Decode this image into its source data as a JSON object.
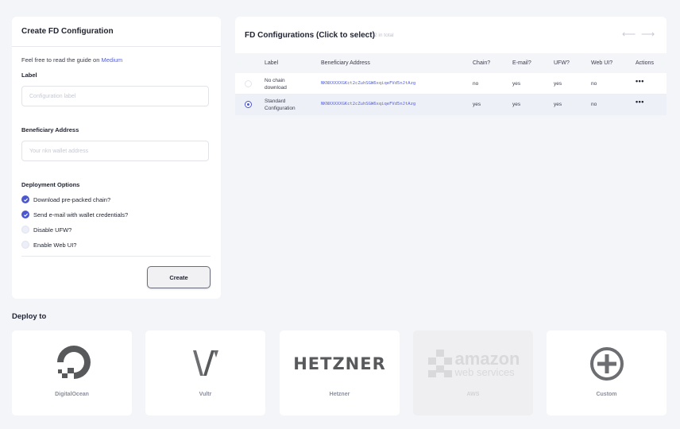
{
  "form": {
    "title": "Create FD Configuration",
    "guide_text": "Feel free to read the guide on ",
    "guide_link": "Medium",
    "label_heading": "Label",
    "label_placeholder": "Configuration label",
    "address_heading": "Beneficiary Address",
    "address_placeholder": "Your nkn wallet address",
    "options_heading": "Deployment Options",
    "options": [
      {
        "label": "Download pre-packed chain?",
        "checked": true
      },
      {
        "label": "Send e-mail with wallet credentials?",
        "checked": true
      },
      {
        "label": "Disable UFW?",
        "checked": false
      },
      {
        "label": "Enable Web UI?",
        "checked": false
      }
    ],
    "create_label": "Create"
  },
  "table": {
    "title": "FD Configurations (Click to select)",
    "total": "2 in total",
    "prev_arrow": "⟵",
    "next_arrow": "⟶",
    "columns": [
      "Label",
      "Beneficiary Address",
      "Chain?",
      "E-mail?",
      "UFW?",
      "Web UI?",
      "Actions"
    ],
    "rows": [
      {
        "label_1": "No chain",
        "label_2": "download",
        "address": "NKNXXXXXGKct2cZuhSGW6xqiqeFVd5nJtAzg",
        "chain": "no",
        "email": "yes",
        "ufw": "yes",
        "webui": "no",
        "actions": "•••",
        "selected": false
      },
      {
        "label_1": "Standard",
        "label_2": "Configuration",
        "address": "NKNXXXXXGKct2cZuhSGW6xqiqeFVd5nJtAzg",
        "chain": "yes",
        "email": "yes",
        "ufw": "yes",
        "webui": "no",
        "actions": "•••",
        "selected": true
      }
    ]
  },
  "deploy": {
    "title": "Deploy to",
    "providers": [
      {
        "name": "DigitalOcean",
        "icon": "digitalocean-logo-icon",
        "disabled": false
      },
      {
        "name": "Vultr",
        "icon": "vultr-logo-icon",
        "disabled": false
      },
      {
        "name": "Hetzner",
        "icon": "hetzner-logo-icon",
        "logo_text": "HETZNER",
        "disabled": false
      },
      {
        "name": "AWS",
        "icon": "aws-logo-icon",
        "logo_text_1": "amazon",
        "logo_text_2": "web services",
        "disabled": true
      },
      {
        "name": "Custom",
        "icon": "plus-circle-icon",
        "disabled": false
      }
    ]
  },
  "colors": {
    "accent": "#4b57d1",
    "link": "#5561d8",
    "background": "#f4f5f9",
    "selected_row": "#eef0f8"
  }
}
